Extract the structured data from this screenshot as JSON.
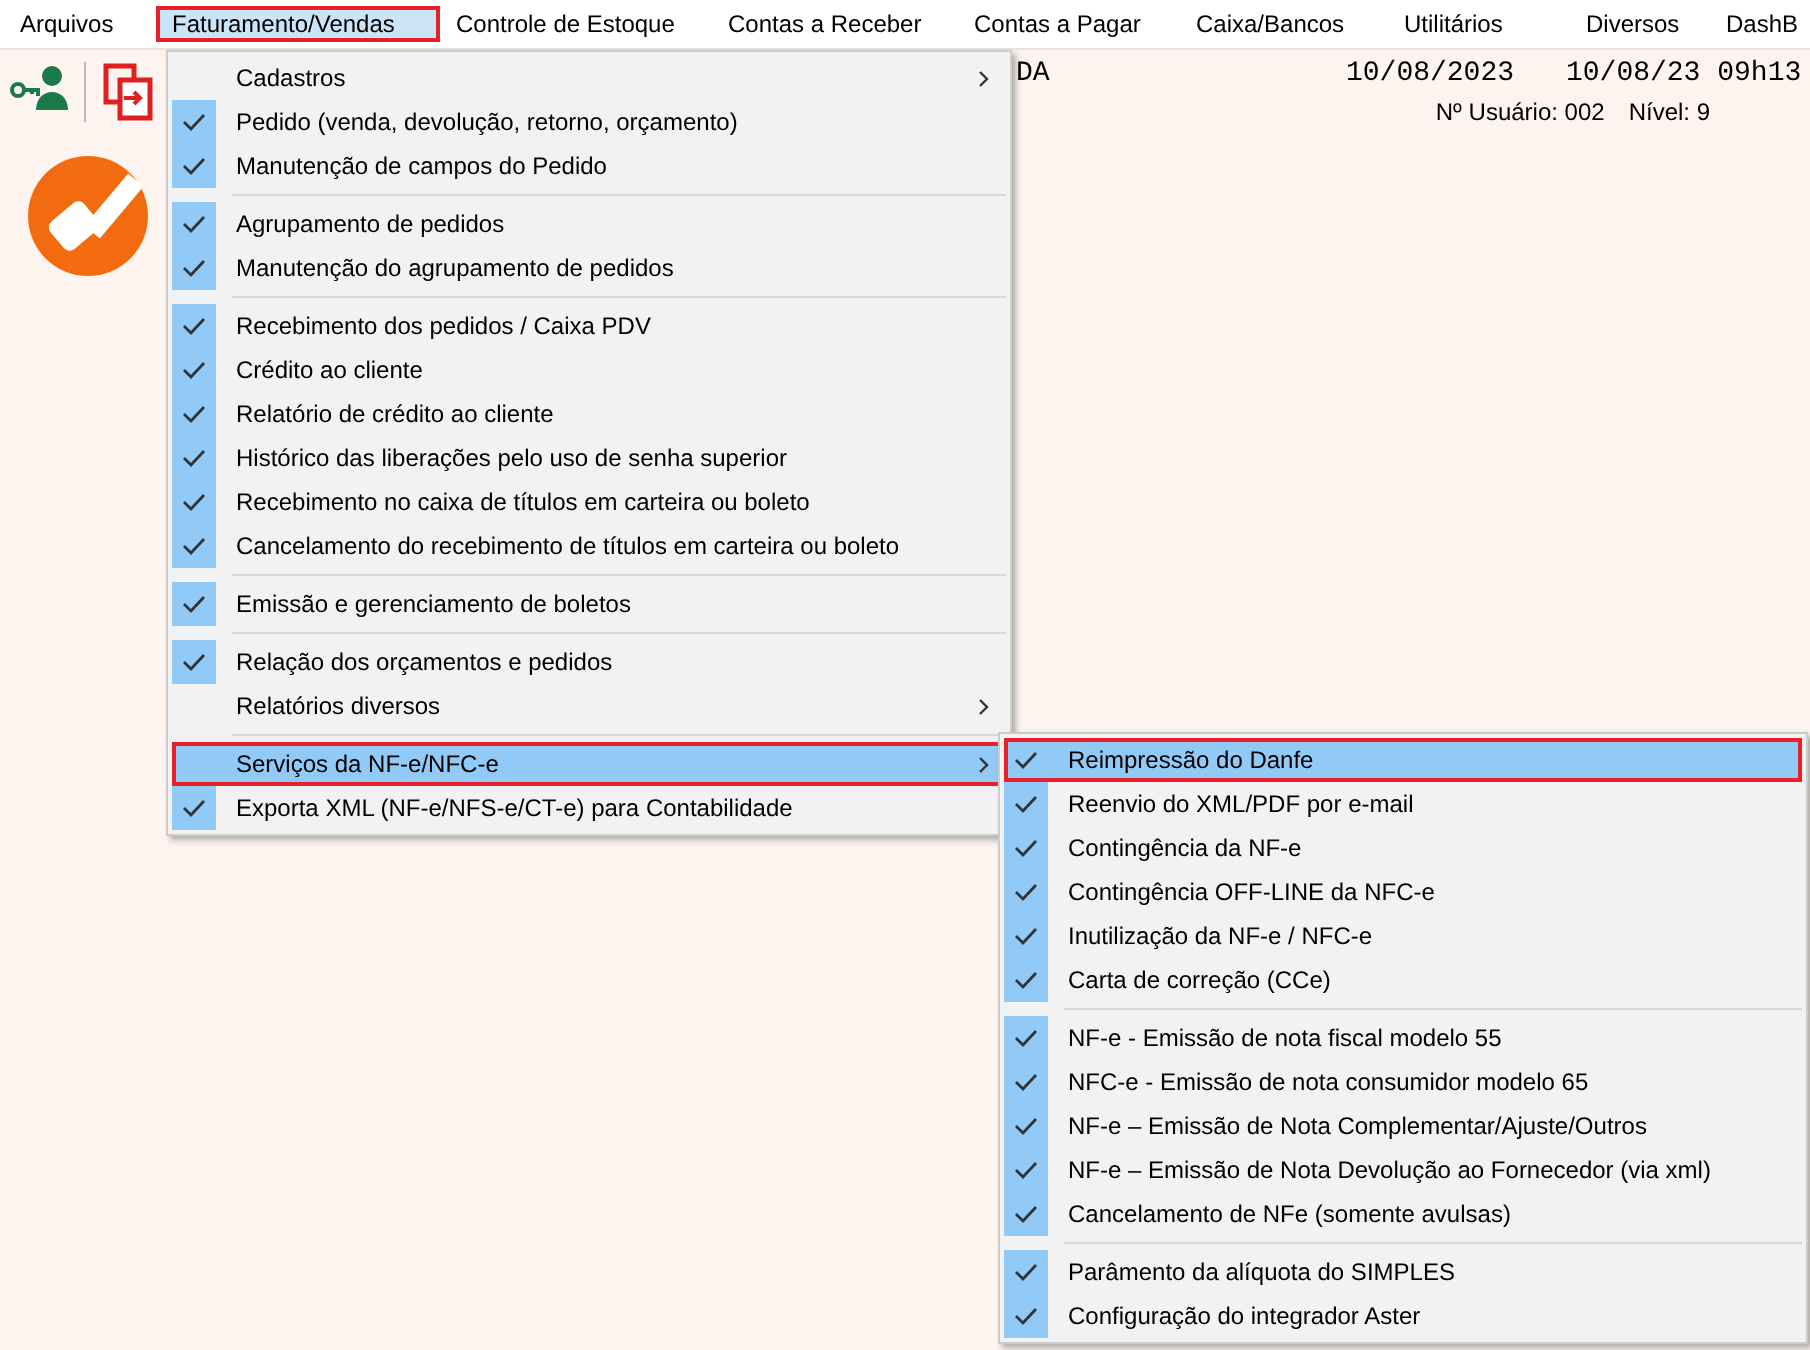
{
  "menubar": [
    {
      "label": "Arquivos",
      "selected": false
    },
    {
      "label": "Faturamento/Vendas",
      "selected": true
    },
    {
      "label": "Controle de Estoque",
      "selected": false
    },
    {
      "label": "Contas a Receber",
      "selected": false
    },
    {
      "label": "Contas a Pagar",
      "selected": false
    },
    {
      "label": "Caixa/Bancos",
      "selected": false
    },
    {
      "label": "Utilitários",
      "selected": false
    },
    {
      "label": "Diversos",
      "selected": false
    },
    {
      "label": "DashB",
      "selected": false
    }
  ],
  "header": {
    "partial_title": "DA",
    "date": "10/08/2023",
    "date_time": "10/08/23 09h13",
    "user": "Nº Usuário: 002",
    "level": "Nível: 9"
  },
  "menu": {
    "groups": [
      [
        {
          "label": "Cadastros",
          "checked": false,
          "submenu": true,
          "selected": false
        },
        {
          "label": "Pedido (venda, devolução, retorno, orçamento)",
          "checked": true,
          "submenu": false,
          "selected": false
        },
        {
          "label": "Manutenção de campos do Pedido",
          "checked": true,
          "submenu": false,
          "selected": false
        }
      ],
      [
        {
          "label": "Agrupamento de pedidos",
          "checked": true,
          "submenu": false,
          "selected": false
        },
        {
          "label": "Manutenção do agrupamento de pedidos",
          "checked": true,
          "submenu": false,
          "selected": false
        }
      ],
      [
        {
          "label": "Recebimento dos pedidos / Caixa PDV",
          "checked": true,
          "submenu": false,
          "selected": false
        },
        {
          "label": "Crédito ao cliente",
          "checked": true,
          "submenu": false,
          "selected": false
        },
        {
          "label": "Relatório de crédito ao cliente",
          "checked": true,
          "submenu": false,
          "selected": false
        },
        {
          "label": "Histórico das liberações pelo uso de senha superior",
          "checked": true,
          "submenu": false,
          "selected": false
        },
        {
          "label": "Recebimento no caixa de títulos em carteira ou boleto",
          "checked": true,
          "submenu": false,
          "selected": false
        },
        {
          "label": "Cancelamento do recebimento de títulos em carteira ou boleto",
          "checked": true,
          "submenu": false,
          "selected": false
        }
      ],
      [
        {
          "label": "Emissão e gerenciamento de boletos",
          "checked": true,
          "submenu": false,
          "selected": false
        }
      ],
      [
        {
          "label": "Relação dos orçamentos e pedidos",
          "checked": true,
          "submenu": false,
          "selected": false
        },
        {
          "label": "Relatórios diversos",
          "checked": false,
          "submenu": true,
          "selected": false
        }
      ],
      [
        {
          "label": "Serviços da NF-e/NFC-e",
          "checked": false,
          "submenu": true,
          "selected": true
        },
        {
          "label": "Exporta XML (NF-e/NFS-e/CT-e) para Contabilidade",
          "checked": true,
          "submenu": false,
          "selected": false
        }
      ]
    ]
  },
  "submenu": {
    "groups": [
      [
        {
          "label": "Reimpressão do Danfe",
          "checked": true,
          "selected": true
        },
        {
          "label": "Reenvio do XML/PDF por e-mail",
          "checked": true,
          "selected": false
        },
        {
          "label": "Contingência da NF-e",
          "checked": true,
          "selected": false
        },
        {
          "label": "Contingência OFF-LINE da NFC-e",
          "checked": true,
          "selected": false
        },
        {
          "label": "Inutilização da NF-e / NFC-e",
          "checked": true,
          "selected": false
        },
        {
          "label": "Carta de correção (CCe)",
          "checked": true,
          "selected": false
        }
      ],
      [
        {
          "label": "NF-e - Emissão de nota fiscal modelo 55",
          "checked": true,
          "selected": false
        },
        {
          "label": "NFC-e - Emissão de nota consumidor modelo 65",
          "checked": true,
          "selected": false
        },
        {
          "label": "NF-e – Emissão de Nota Complementar/Ajuste/Outros",
          "checked": true,
          "selected": false
        },
        {
          "label": "NF-e – Emissão de Nota Devolução ao Fornecedor (via xml)",
          "checked": true,
          "selected": false
        },
        {
          "label": "Cancelamento de NFe (somente avulsas)",
          "checked": true,
          "selected": false
        }
      ],
      [
        {
          "label": "Parâmento da alíquota do SIMPLES",
          "checked": true,
          "selected": false
        },
        {
          "label": "Configuração do integrador Aster",
          "checked": true,
          "selected": false
        }
      ]
    ]
  }
}
